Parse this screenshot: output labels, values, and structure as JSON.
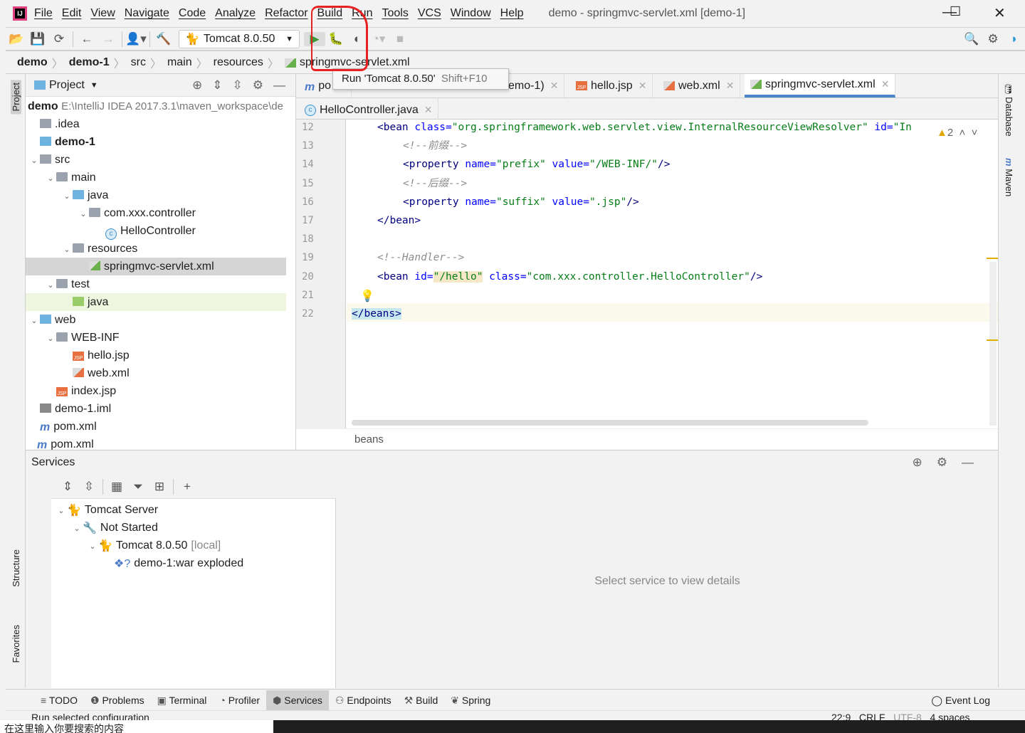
{
  "window": {
    "title": "demo - springmvc-servlet.xml [demo-1]"
  },
  "menu": [
    "File",
    "Edit",
    "View",
    "Navigate",
    "Code",
    "Analyze",
    "Refactor",
    "Build",
    "Run",
    "Tools",
    "VCS",
    "Window",
    "Help"
  ],
  "toolbar": {
    "run_config": "Tomcat 8.0.50",
    "tooltip_label": "Run 'Tomcat 8.0.50'",
    "tooltip_shortcut": "Shift+F10"
  },
  "breadcrumb": [
    "demo",
    "demo-1",
    "src",
    "main",
    "resources",
    "springmvc-servlet.xml"
  ],
  "left_strip": {
    "project": "Project",
    "structure": "Structure",
    "favorites": "Favorites"
  },
  "right_strip": {
    "database": "Database",
    "maven": "Maven"
  },
  "project": {
    "title": "Project",
    "root_name": "demo",
    "root_path": "E:\\IntelliJ IDEA 2017.3.1\\maven_workspace\\de",
    "items": [
      {
        "label": ".idea",
        "depth": 0,
        "icon": "folder",
        "arrow": ""
      },
      {
        "label": "demo-1",
        "depth": 0,
        "icon": "module-folder",
        "arrow": "",
        "bold": true
      },
      {
        "label": "src",
        "depth": 0,
        "icon": "folder",
        "arrow": "v"
      },
      {
        "label": "main",
        "depth": 1,
        "icon": "folder",
        "arrow": "v"
      },
      {
        "label": "java",
        "depth": 2,
        "icon": "source-folder",
        "arrow": "v"
      },
      {
        "label": "com.xxx.controller",
        "depth": 3,
        "icon": "package",
        "arrow": "v"
      },
      {
        "label": "HelloController",
        "depth": 4,
        "icon": "class",
        "arrow": ""
      },
      {
        "label": "resources",
        "depth": 2,
        "icon": "resources-folder",
        "arrow": "v"
      },
      {
        "label": "springmvc-servlet.xml",
        "depth": 3,
        "icon": "spring-xml",
        "arrow": "",
        "selected": true
      },
      {
        "label": "test",
        "depth": 1,
        "icon": "folder",
        "arrow": "v"
      },
      {
        "label": "java",
        "depth": 2,
        "icon": "test-folder",
        "arrow": "",
        "highlight": true
      },
      {
        "label": "web",
        "depth": 0,
        "icon": "web-folder",
        "arrow": "v"
      },
      {
        "label": "WEB-INF",
        "depth": 1,
        "icon": "folder",
        "arrow": "v"
      },
      {
        "label": "hello.jsp",
        "depth": 2,
        "icon": "jsp",
        "arrow": ""
      },
      {
        "label": "web.xml",
        "depth": 2,
        "icon": "xml",
        "arrow": ""
      },
      {
        "label": "index.jsp",
        "depth": 1,
        "icon": "jsp",
        "arrow": ""
      },
      {
        "label": "demo-1.iml",
        "depth": 0,
        "icon": "iml",
        "arrow": ""
      },
      {
        "label": "pom.xml",
        "depth": 0,
        "icon": "maven",
        "arrow": ""
      },
      {
        "label": "pom.xml",
        "depth": -1,
        "icon": "maven",
        "arrow": ""
      }
    ]
  },
  "editor_tabs": {
    "row1": [
      {
        "label": "po",
        "icon": "maven"
      },
      {
        "label": "emo-1)",
        "icon": ""
      },
      {
        "label": "hello.jsp",
        "icon": "jsp"
      },
      {
        "label": "web.xml",
        "icon": "xml"
      },
      {
        "label": "springmvc-servlet.xml",
        "icon": "spring-xml",
        "active": true
      }
    ],
    "row2": [
      {
        "label": "HelloController.java",
        "icon": "class"
      }
    ]
  },
  "editor": {
    "warnings": "2",
    "lines": [
      {
        "n": "12",
        "indent": 1,
        "tokens": [
          [
            "tag",
            "<bean "
          ],
          [
            "attr",
            "class="
          ],
          [
            "val",
            "\"org.springframework.web.servlet.view.InternalResourceViewResolver\""
          ],
          [
            "tag",
            " "
          ],
          [
            "attr",
            "id="
          ],
          [
            "val",
            "\"In"
          ]
        ]
      },
      {
        "n": "13",
        "indent": 2,
        "tokens": [
          [
            "cm",
            "<!--前缀-->"
          ]
        ]
      },
      {
        "n": "14",
        "indent": 2,
        "tokens": [
          [
            "tag",
            "<property "
          ],
          [
            "attr",
            "name="
          ],
          [
            "val",
            "\"prefix\""
          ],
          [
            "tag",
            " "
          ],
          [
            "attr",
            "value="
          ],
          [
            "val",
            "\"/WEB-INF/\""
          ],
          [
            "tag",
            "/>"
          ]
        ]
      },
      {
        "n": "15",
        "indent": 2,
        "tokens": [
          [
            "cm",
            "<!--后缀-->"
          ]
        ]
      },
      {
        "n": "16",
        "indent": 2,
        "tokens": [
          [
            "tag",
            "<property "
          ],
          [
            "attr",
            "name="
          ],
          [
            "val",
            "\"suffix\""
          ],
          [
            "tag",
            " "
          ],
          [
            "attr",
            "value="
          ],
          [
            "val",
            "\".jsp\""
          ],
          [
            "tag",
            "/>"
          ]
        ]
      },
      {
        "n": "17",
        "indent": 1,
        "tokens": [
          [
            "tag",
            "</bean>"
          ]
        ]
      },
      {
        "n": "18",
        "indent": 0,
        "tokens": []
      },
      {
        "n": "19",
        "indent": 1,
        "tokens": [
          [
            "cm",
            "<!--Handler-->"
          ]
        ]
      },
      {
        "n": "20",
        "indent": 1,
        "tokens": [
          [
            "tag",
            "<bean "
          ],
          [
            "attr",
            "id="
          ],
          [
            "val",
            "\"/hello\""
          ],
          [
            "tag",
            " "
          ],
          [
            "attr",
            "class="
          ],
          [
            "val",
            "\"com.xxx.controller.HelloController\""
          ],
          [
            "tag",
            "/>"
          ]
        ]
      },
      {
        "n": "21",
        "indent": 0,
        "tokens": []
      },
      {
        "n": "22",
        "indent": 0,
        "tokens": [
          [
            "tag",
            "</beans>"
          ]
        ]
      }
    ],
    "breadcrumb": "beans"
  },
  "services": {
    "title": "Services",
    "tree": [
      {
        "label": "Tomcat Server",
        "depth": 0,
        "icon": "tomcat"
      },
      {
        "label": "Not Started",
        "depth": 1,
        "icon": "wrench"
      },
      {
        "label": "Tomcat 8.0.50",
        "suffix": "[local]",
        "depth": 2,
        "icon": "tomcat"
      },
      {
        "label": "demo-1:war exploded",
        "depth": 3,
        "icon": "artifact"
      }
    ],
    "empty_text": "Select service to view details"
  },
  "bottom_tabs": [
    "TODO",
    "Problems",
    "Terminal",
    "Profiler",
    "Services",
    "Endpoints",
    "Build",
    "Spring"
  ],
  "bottom_active": "Services",
  "event_log": "Event Log",
  "status": {
    "message": "Run selected configuration",
    "position": "22:9",
    "line_sep": "CRLF",
    "encoding": "UTF-8",
    "indent": "4 spaces"
  },
  "desktop_text": "在这里输入你要搜索的内容"
}
